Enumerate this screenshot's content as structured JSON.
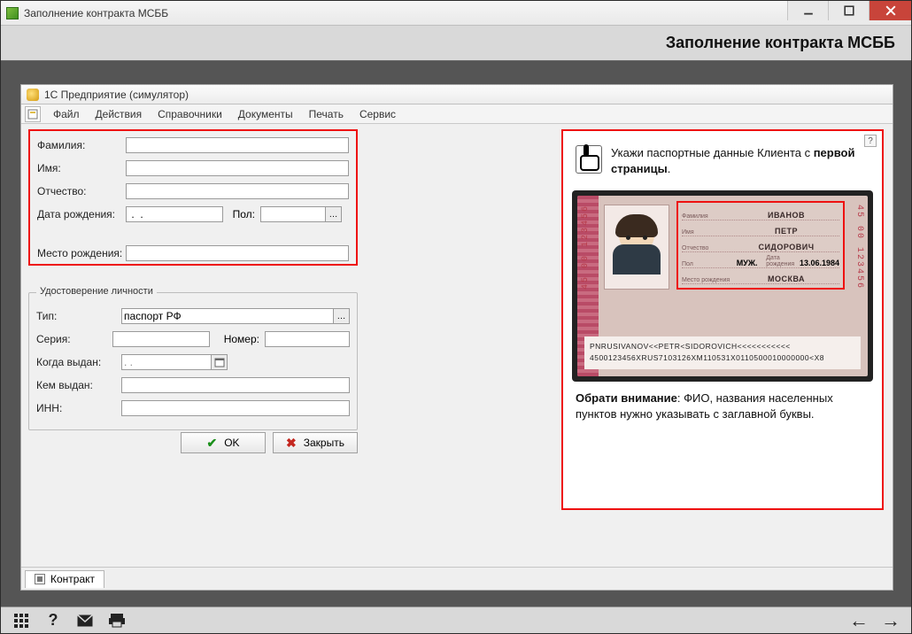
{
  "window": {
    "title": "Заполнение контракта МСББ"
  },
  "page_header": "Заполнение контракта МСББ",
  "subwindow": {
    "title": "1С Предприятие (симулятор)",
    "menu": [
      "Файл",
      "Действия",
      "Справочники",
      "Документы",
      "Печать",
      "Сервис"
    ]
  },
  "form": {
    "labels": {
      "surname": "Фамилия:",
      "name": "Имя:",
      "patronymic": "Отчество:",
      "birthdate": "Дата рождения:",
      "sex": "Пол:",
      "birthplace": "Место рождения:"
    },
    "values": {
      "surname": "",
      "name": "",
      "patronymic": "",
      "birthdate": " .  .    ",
      "sex": "",
      "birthplace": ""
    }
  },
  "id_group": {
    "legend": "Удостоверение личности",
    "labels": {
      "type": "Тип:",
      "series": "Серия:",
      "number": "Номер:",
      "issued_when": "Когда выдан:",
      "issued_by": "Кем выдан:",
      "inn": "ИНН:"
    },
    "values": {
      "type": "паспорт РФ",
      "series": "",
      "number": "",
      "issued_when": " .  .    ",
      "issued_by": "",
      "inn": ""
    }
  },
  "buttons": {
    "ok": "OK",
    "close": "Закрыть"
  },
  "help": {
    "line1": "Укажи паспортные данные Клиента с ",
    "line1_bold": "первой страницы",
    "note_bold": "Обрати внимание",
    "note_rest": ": ФИО, названия населенных пунктов нужно указывать с заглавной буквы."
  },
  "passport": {
    "side_number": "45 00 123456",
    "fields": {
      "surname_k": "Фамилия",
      "surname_v": "ИВАНОВ",
      "name_k": "Имя",
      "name_v": "ПЕТР",
      "patr_k": "Отчество",
      "patr_v": "СИДОРОВИЧ",
      "sex_k": "Пол",
      "sex_v": "МУЖ.",
      "dob_k": "Дата рождения",
      "dob_v": "13.06.1984",
      "pob_k": "Место рождения",
      "pob_v": "МОСКВА"
    },
    "mrz1": "PNRUSIVANOV<<PETR<SIDOROVICH<<<<<<<<<<<",
    "mrz2": "4500123456XRUS7103126XM110531X0110500010000000<X8"
  },
  "tabstrip": {
    "tab1": "Контракт"
  }
}
